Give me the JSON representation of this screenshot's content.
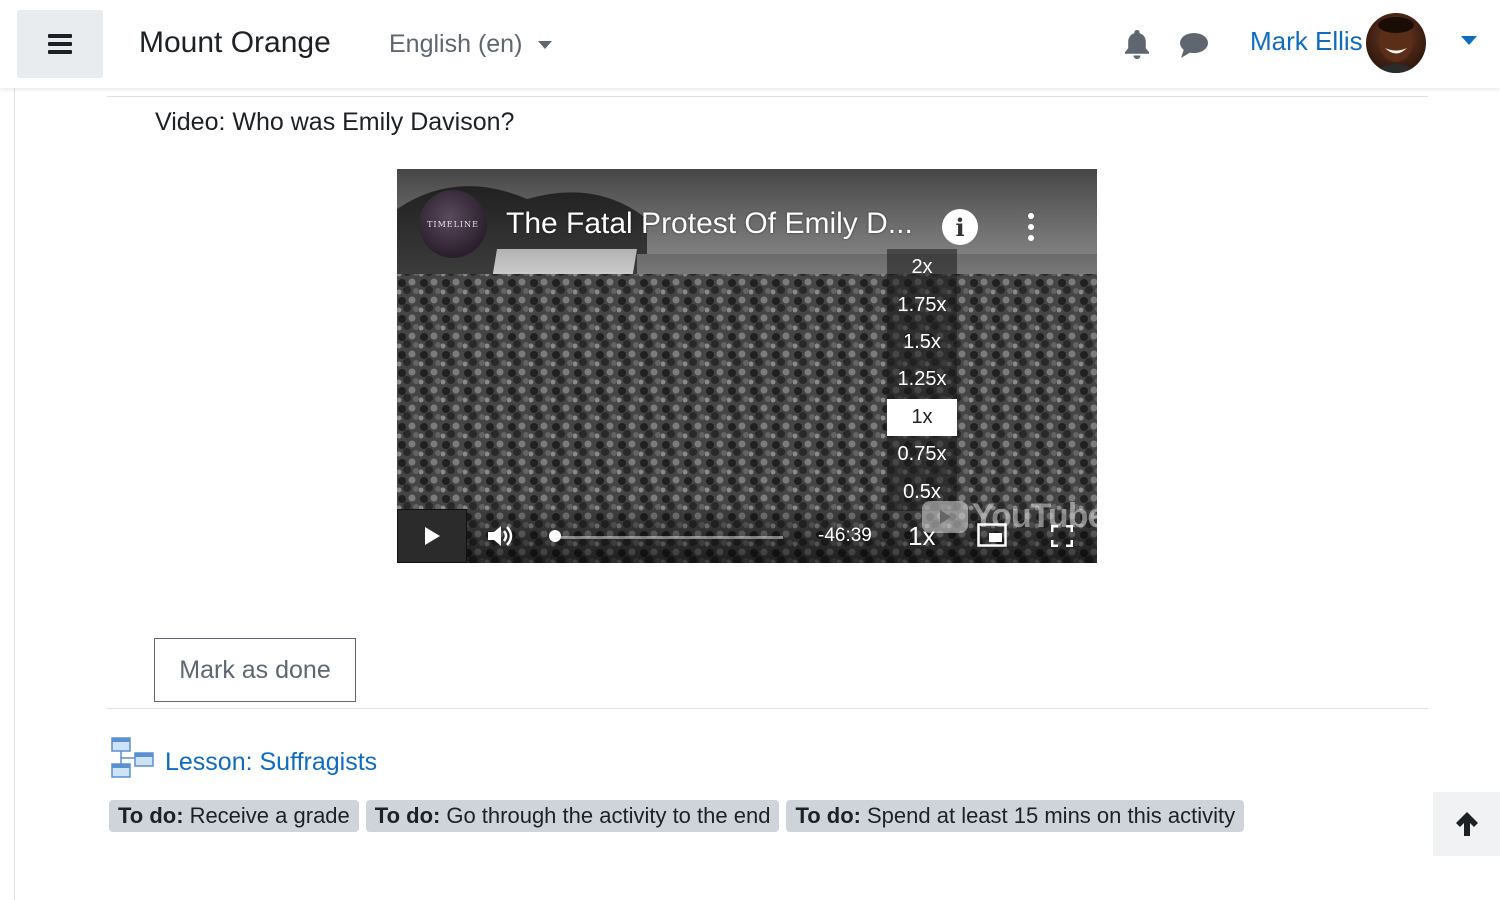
{
  "navbar": {
    "site_name": "Mount Orange",
    "language": "English (en)",
    "user_name": "Mark Ellis"
  },
  "activity": {
    "video_title": "Video: Who was Emily Davison?"
  },
  "video": {
    "channel_logo_text": "TIMELINE",
    "heading": "The Fatal Protest Of Emily D...",
    "info_label": "i",
    "time_remaining": "-46:39",
    "progress": 0.02,
    "speed_button": "1x",
    "speed_options": [
      "2x",
      "1.75x",
      "1.5x",
      "1.25x",
      "1x",
      "0.75x",
      "0.5x"
    ],
    "speed_selected": "1x",
    "brand": "YouTube"
  },
  "completion": {
    "mark_done_label": "Mark as done"
  },
  "lesson": {
    "link_text": "Lesson: Suffragists",
    "todos": [
      {
        "prefix": "To do:",
        "text": "Receive a grade"
      },
      {
        "prefix": "To do:",
        "text": "Go through the activity to the end"
      },
      {
        "prefix": "To do:",
        "text": "Spend at least 15 mins on this activity"
      }
    ]
  },
  "colors": {
    "link": "#0f6cbf",
    "badge_bg": "#ced4da",
    "nav_button_bg": "#e9ecef"
  },
  "icons": [
    "menu-icon",
    "caret-down-icon",
    "bell-icon",
    "chat-icon",
    "play-icon",
    "volume-icon",
    "pip-icon",
    "fullscreen-icon",
    "lesson-icon",
    "arrow-up-icon"
  ]
}
